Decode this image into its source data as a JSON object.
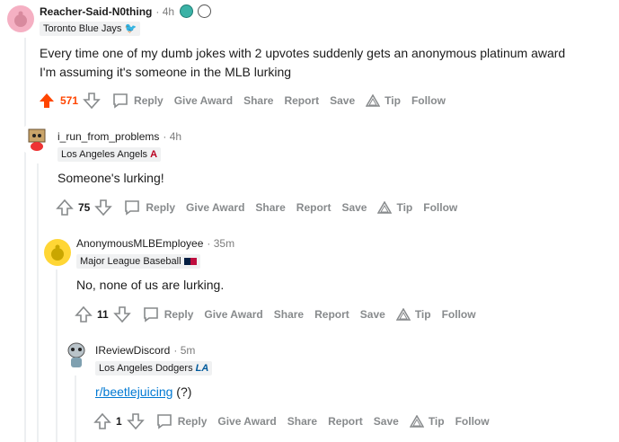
{
  "comments": [
    {
      "username": "Reacher-Said-N0thing",
      "time": "· 4h",
      "flair": "Toronto Blue Jays",
      "body": [
        "Every time one of my dumb jokes with 2 upvotes suddenly gets an anonymous platinum award",
        "I'm assuming it's someone in the MLB lurking"
      ],
      "score": "571",
      "actions": {
        "reply": "Reply",
        "give_award": "Give Award",
        "share": "Share",
        "report": "Report",
        "save": "Save",
        "tip": "Tip",
        "follow": "Follow"
      }
    },
    {
      "username": "i_run_from_problems",
      "time": "· 4h",
      "flair": "Los Angeles Angels",
      "body": [
        "Someone's lurking!"
      ],
      "score": "75",
      "actions": {
        "reply": "Reply",
        "give_award": "Give Award",
        "share": "Share",
        "report": "Report",
        "save": "Save",
        "tip": "Tip",
        "follow": "Follow"
      }
    },
    {
      "username": "AnonymousMLBEmployee",
      "time": "· 35m",
      "flair": "Major League Baseball",
      "body": [
        "No, none of us are lurking."
      ],
      "score": "11",
      "actions": {
        "reply": "Reply",
        "give_award": "Give Award",
        "share": "Share",
        "report": "Report",
        "save": "Save",
        "tip": "Tip",
        "follow": "Follow"
      }
    },
    {
      "username": "IReviewDiscord",
      "time": "· 5m",
      "flair": "Los Angeles Dodgers",
      "body_link": "r/beetlejuicing",
      "body_suffix": " (?)",
      "score": "1",
      "actions": {
        "reply": "Reply",
        "give_award": "Give Award",
        "share": "Share",
        "report": "Report",
        "save": "Save",
        "tip": "Tip",
        "follow": "Follow"
      }
    }
  ],
  "colors": {
    "upvote_active": "#ff4500",
    "link": "#0079d3",
    "muted": "#878a8c"
  }
}
